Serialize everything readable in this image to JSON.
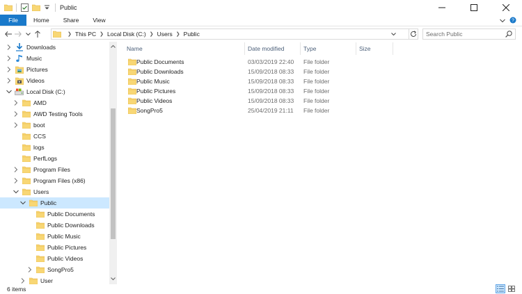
{
  "window": {
    "title": "Public"
  },
  "ribbon": {
    "tabs": [
      "File",
      "Home",
      "Share",
      "View"
    ]
  },
  "address": {
    "crumbs": [
      "This PC",
      "Local Disk (C:)",
      "Users",
      "Public"
    ]
  },
  "search": {
    "placeholder": "Search Public"
  },
  "nav": {
    "items": [
      {
        "label": "Downloads",
        "icon": "downloads-icon",
        "indent": 0,
        "expander": "collapsed",
        "selected": false
      },
      {
        "label": "Music",
        "icon": "music-icon",
        "indent": 0,
        "expander": "collapsed",
        "selected": false
      },
      {
        "label": "Pictures",
        "icon": "pictures-icon",
        "indent": 0,
        "expander": "collapsed",
        "selected": false
      },
      {
        "label": "Videos",
        "icon": "videos-icon",
        "indent": 0,
        "expander": "collapsed",
        "selected": false
      },
      {
        "label": "Local Disk (C:)",
        "icon": "drive-icon",
        "indent": 0,
        "expander": "expanded",
        "selected": false
      },
      {
        "label": "AMD",
        "icon": "folder-icon",
        "indent": 1,
        "expander": "collapsed",
        "selected": false
      },
      {
        "label": "AWD Testing Tools",
        "icon": "folder-icon",
        "indent": 1,
        "expander": "collapsed",
        "selected": false
      },
      {
        "label": "boot",
        "icon": "folder-icon",
        "indent": 1,
        "expander": "collapsed",
        "selected": false
      },
      {
        "label": "CCS",
        "icon": "folder-icon",
        "indent": 1,
        "expander": "none",
        "selected": false
      },
      {
        "label": "logs",
        "icon": "folder-icon",
        "indent": 1,
        "expander": "none",
        "selected": false
      },
      {
        "label": "PerfLogs",
        "icon": "folder-icon",
        "indent": 1,
        "expander": "none",
        "selected": false
      },
      {
        "label": "Program Files",
        "icon": "folder-icon",
        "indent": 1,
        "expander": "collapsed",
        "selected": false
      },
      {
        "label": "Program Files (x86)",
        "icon": "folder-icon",
        "indent": 1,
        "expander": "collapsed",
        "selected": false
      },
      {
        "label": "Users",
        "icon": "folder-icon",
        "indent": 1,
        "expander": "expanded",
        "selected": false
      },
      {
        "label": "Public",
        "icon": "folder-icon",
        "indent": 2,
        "expander": "expanded",
        "selected": true
      },
      {
        "label": "Public Documents",
        "icon": "folder-icon",
        "indent": 3,
        "expander": "none",
        "selected": false
      },
      {
        "label": "Public Downloads",
        "icon": "folder-icon",
        "indent": 3,
        "expander": "none",
        "selected": false
      },
      {
        "label": "Public Music",
        "icon": "folder-icon",
        "indent": 3,
        "expander": "none",
        "selected": false
      },
      {
        "label": "Public Pictures",
        "icon": "folder-icon",
        "indent": 3,
        "expander": "none",
        "selected": false
      },
      {
        "label": "Public Videos",
        "icon": "folder-icon",
        "indent": 3,
        "expander": "none",
        "selected": false
      },
      {
        "label": "SongPro5",
        "icon": "folder-icon",
        "indent": 3,
        "expander": "collapsed",
        "selected": false
      },
      {
        "label": "User",
        "icon": "folder-icon",
        "indent": 2,
        "expander": "collapsed",
        "selected": false
      }
    ]
  },
  "files": {
    "columns": [
      "Name",
      "Date modified",
      "Type",
      "Size"
    ],
    "rows": [
      {
        "name": "Public Documents",
        "date": "03/03/2019 22:40",
        "type": "File folder",
        "size": ""
      },
      {
        "name": "Public Downloads",
        "date": "15/09/2018 08:33",
        "type": "File folder",
        "size": ""
      },
      {
        "name": "Public Music",
        "date": "15/09/2018 08:33",
        "type": "File folder",
        "size": ""
      },
      {
        "name": "Public Pictures",
        "date": "15/09/2018 08:33",
        "type": "File folder",
        "size": ""
      },
      {
        "name": "Public Videos",
        "date": "15/09/2018 08:33",
        "type": "File folder",
        "size": ""
      },
      {
        "name": "SongPro5",
        "date": "25/04/2019 21:11",
        "type": "File folder",
        "size": ""
      }
    ]
  },
  "status": {
    "item_count": "6 items"
  },
  "colors": {
    "accent": "#1979ca",
    "selection": "#cce8ff",
    "folder": "#f8d775",
    "folder_dark": "#e8b84a"
  }
}
